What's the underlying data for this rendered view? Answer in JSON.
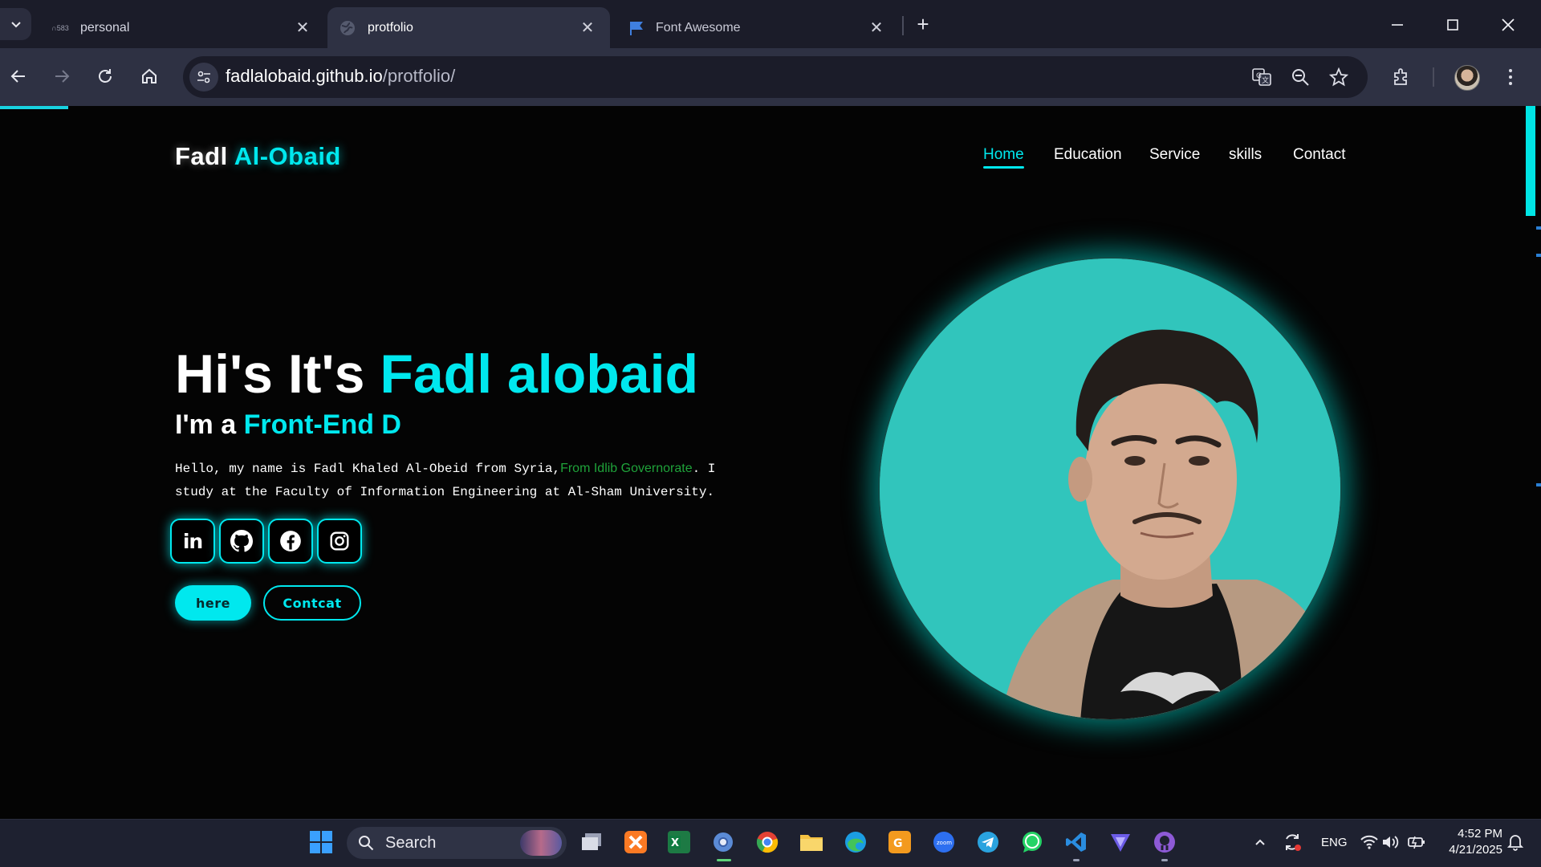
{
  "browser": {
    "tabs": [
      {
        "title": "personal",
        "favicon_text": "∩583"
      },
      {
        "title": "protfolio"
      },
      {
        "title": "Font Awesome"
      }
    ],
    "url_domain": "fadlalobaid.github.io",
    "url_path": "/protfolio/"
  },
  "site": {
    "logo_first": "Fadl",
    "logo_accent": "Al-Obaid",
    "nav": [
      "Home",
      "Education",
      "Service",
      "skills",
      "Contact"
    ],
    "hero": {
      "title_start": "Hi's It's",
      "title_accent": "Fadl alobaid",
      "sub_start": "I'm a",
      "sub_accent": "Front-End D",
      "text_before": "Hello, my name is Fadl Khaled Al-Obeid from Syria,",
      "text_green": "From Idlib Governorate",
      "text_after": ". I study at the Faculty of Information Engineering at Al-Sham University."
    },
    "social_icons": [
      "linkedin-icon",
      "github-icon",
      "facebook-icon",
      "instagram-icon"
    ],
    "buttons": {
      "primary": "here",
      "secondary": "Contcat"
    },
    "colors": {
      "accent": "#00e8ee",
      "background": "#040404",
      "green": "#1fa23a",
      "photo_bg": "#31c5bc"
    }
  },
  "taskbar": {
    "search_label": "Search",
    "language": "ENG",
    "time": "4:52 PM",
    "date": "4/21/2025"
  }
}
